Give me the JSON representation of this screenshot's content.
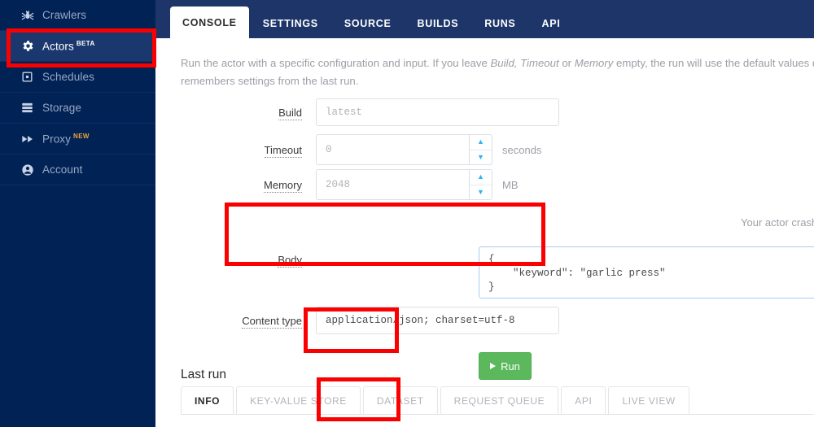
{
  "sidebar": {
    "items": [
      {
        "label": "Crawlers",
        "icon": "spider-icon",
        "active": false,
        "badge": ""
      },
      {
        "label": "Actors",
        "icon": "gear-icon",
        "active": true,
        "badge": "BETA"
      },
      {
        "label": "Schedules",
        "icon": "schedule-icon",
        "active": false,
        "badge": ""
      },
      {
        "label": "Storage",
        "icon": "storage-icon",
        "active": false,
        "badge": ""
      },
      {
        "label": "Proxy",
        "icon": "fast-forward-icon",
        "active": false,
        "badge": "NEW"
      },
      {
        "label": "Account",
        "icon": "account-icon",
        "active": false,
        "badge": ""
      }
    ]
  },
  "top_tabs": [
    {
      "label": "CONSOLE",
      "active": true
    },
    {
      "label": "SETTINGS",
      "active": false
    },
    {
      "label": "SOURCE",
      "active": false
    },
    {
      "label": "BUILDS",
      "active": false
    },
    {
      "label": "RUNS",
      "active": false
    },
    {
      "label": "API",
      "active": false
    }
  ],
  "console": {
    "description_line1_a": "Run the actor with a specific configuration and input. If you leave ",
    "description_italic1": "Build, Timeout",
    "description_line1_b": " or ",
    "description_italic2": "Memory",
    "description_line1_c": " empty, the run will use the default values defined in th",
    "description_line2": "remembers settings from the last run.",
    "fields": {
      "build": {
        "label": "Build",
        "value": "",
        "placeholder": "latest"
      },
      "timeout": {
        "label": "Timeout",
        "value": "",
        "placeholder": "0",
        "unit": "seconds"
      },
      "memory": {
        "label": "Memory",
        "value": "",
        "placeholder": "2048",
        "unit": "MB"
      },
      "body": {
        "label": "Body",
        "value": "{\n    \"keyword\": \"garlic press\"\n}"
      },
      "content_type": {
        "label": "Content type",
        "value": "application/json; charset=utf-8"
      }
    },
    "memory_hint": "Your actor crashes or runs too slow? Increasing the me",
    "run_button": "Run"
  },
  "last_run": {
    "title": "Last run",
    "tabs": [
      {
        "label": "INFO",
        "active": true
      },
      {
        "label": "KEY-VALUE STORE",
        "active": false
      },
      {
        "label": "DATASET",
        "active": false
      },
      {
        "label": "REQUEST QUEUE",
        "active": false
      },
      {
        "label": "API",
        "active": false
      },
      {
        "label": "LIVE VIEW",
        "active": false
      }
    ]
  },
  "colors": {
    "sidebar_bg": "#002255",
    "sidebar_active_bg": "#1b386e",
    "sidebar_accent": "#f2a33c",
    "header_bg": "#1d3568",
    "run_green": "#5cb85c",
    "annotation_red": "#fb0000",
    "focus_blue": "#a8cdf0",
    "spinner_blue": "#29b6f6"
  },
  "annotations": [
    {
      "name": "actors-highlight"
    },
    {
      "name": "body-highlight"
    },
    {
      "name": "run-highlight"
    },
    {
      "name": "dataset-highlight"
    }
  ]
}
